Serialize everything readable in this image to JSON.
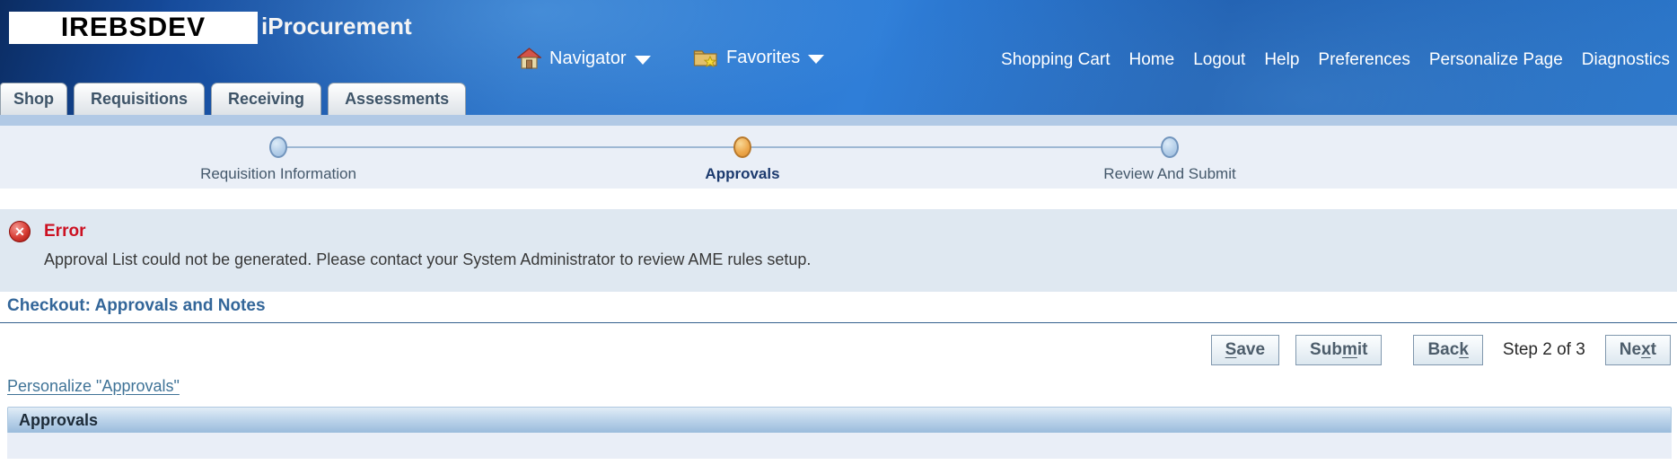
{
  "header": {
    "logo": "IREBSDEV",
    "app_title": "iProcurement",
    "navigator_label": "Navigator",
    "favorites_label": "Favorites",
    "links": [
      "Shopping Cart",
      "Home",
      "Logout",
      "Help",
      "Preferences",
      "Personalize Page",
      "Diagnostics"
    ]
  },
  "tabs": [
    {
      "label": "Shop"
    },
    {
      "label": "Requisitions"
    },
    {
      "label": "Receiving"
    },
    {
      "label": "Assessments"
    }
  ],
  "train": {
    "steps": [
      {
        "label": "Requisition Information",
        "state": "visited"
      },
      {
        "label": "Approvals",
        "state": "current"
      },
      {
        "label": "Review And Submit",
        "state": "future"
      }
    ]
  },
  "error": {
    "title": "Error",
    "message": "Approval List could not be generated. Please contact your System Administrator to review AME rules setup."
  },
  "page": {
    "heading": "Checkout: Approvals and Notes",
    "step_indicator": "Step 2 of 3",
    "personalize_link": "Personalize \"Approvals\"",
    "section_title": "Approvals"
  },
  "buttons": {
    "save": {
      "pre": "",
      "key": "S",
      "post": "ave"
    },
    "submit": {
      "pre": "Sub",
      "key": "m",
      "post": "it"
    },
    "back": {
      "pre": "Bac",
      "key": "k",
      "post": ""
    },
    "next": {
      "pre": "Ne",
      "key": "x",
      "post": "t"
    }
  },
  "colors": {
    "header_blue": "#2a72c8",
    "error_red": "#cc1122",
    "heading_blue": "#336699",
    "link_teal": "#3f7397",
    "current_step_orange": "#eda94e"
  }
}
